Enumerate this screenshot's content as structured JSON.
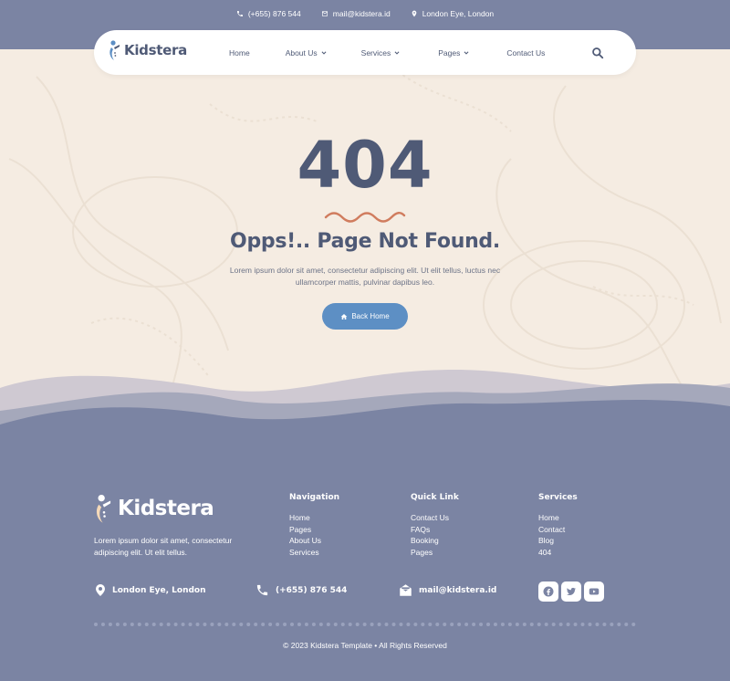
{
  "topbar": {
    "phone": "(+655) 876 544",
    "email": "mail@kidstera.id",
    "location": "London Eye, London"
  },
  "navbar": {
    "brand": "Kidstera",
    "links": [
      {
        "label": "Home",
        "dropdown": false
      },
      {
        "label": "About Us",
        "dropdown": true
      },
      {
        "label": "Services",
        "dropdown": true
      },
      {
        "label": "Pages",
        "dropdown": true
      },
      {
        "label": "Contact Us",
        "dropdown": false
      }
    ],
    "search_icon": "search-icon"
  },
  "hero": {
    "code": "404",
    "title": "Opps!.. Page Not Found.",
    "description": "Lorem ipsum dolor sit amet, consectetur adipiscing elit. Ut elit tellus, luctus nec ullamcorper mattis, pulvinar dapibus leo.",
    "button_label": "Back Home",
    "button_icon": "home-icon"
  },
  "footer": {
    "brand": "Kidstera",
    "description": "Lorem ipsum dolor sit amet, consectetur adipiscing elit. Ut elit tellus.",
    "columns": [
      {
        "title": "Navigation",
        "items": [
          "Home",
          "Pages",
          "About Us",
          "Services"
        ]
      },
      {
        "title": "Quick Link",
        "items": [
          "Contact Us",
          "FAQs",
          "Booking",
          "Pages"
        ]
      },
      {
        "title": "Services",
        "items": [
          "Home",
          "Contact",
          "Blog",
          "404"
        ]
      }
    ],
    "contacts": {
      "location": "London Eye, London",
      "phone": "(+655) 876 544",
      "email": "mail@kidstera.id"
    },
    "socials": [
      "facebook-icon",
      "twitter-icon",
      "youtube-icon"
    ],
    "copyright": "© 2023 Kidstera Template • All Rights Reserved"
  },
  "colors": {
    "primary": "#4f5a76",
    "footer_bg": "#7b84a3",
    "page_bg": "#f5ece2",
    "button": "#5d8fc4",
    "accent_squiggle": "#d07c5e"
  }
}
